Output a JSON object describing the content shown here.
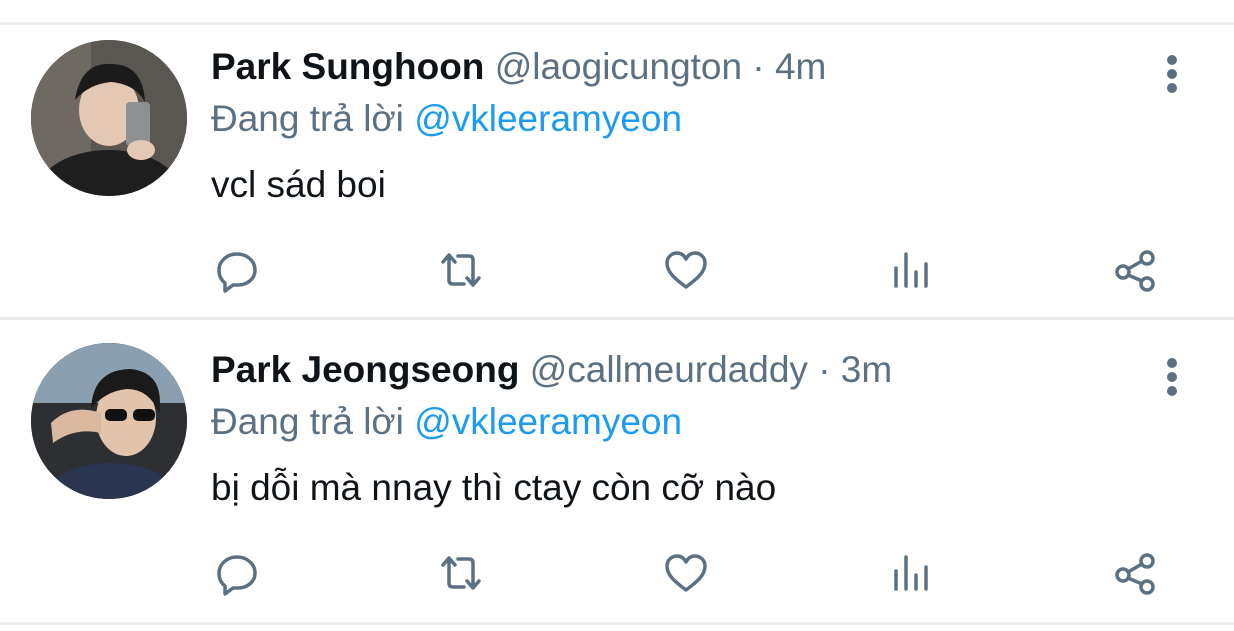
{
  "colors": {
    "name": "#0f1419",
    "secondary": "#5b7083",
    "mention": "#1d9bf0",
    "divider": "#e9ecee"
  },
  "tweets": [
    {
      "display_name": "Park Sunghoon",
      "handle": "@laogicungton",
      "separator": "·",
      "time": "4m",
      "reply_prefix": "Đang trả lời",
      "reply_to": "@vkleeramyeon",
      "text": "vcl sád boi",
      "avatar_icon": "avatar-photo",
      "actions": [
        "reply-icon",
        "retweet-icon",
        "like-icon",
        "analytics-icon",
        "share-icon"
      ]
    },
    {
      "display_name": "Park Jeongseong",
      "handle": "@callmeurdaddy",
      "separator": "·",
      "time": "3m",
      "reply_prefix": "Đang trả lời",
      "reply_to": "@vkleeramyeon",
      "text": "bị dỗi mà nnay thì ctay còn cỡ nào",
      "avatar_icon": "avatar-photo",
      "actions": [
        "reply-icon",
        "retweet-icon",
        "like-icon",
        "analytics-icon",
        "share-icon"
      ]
    }
  ]
}
